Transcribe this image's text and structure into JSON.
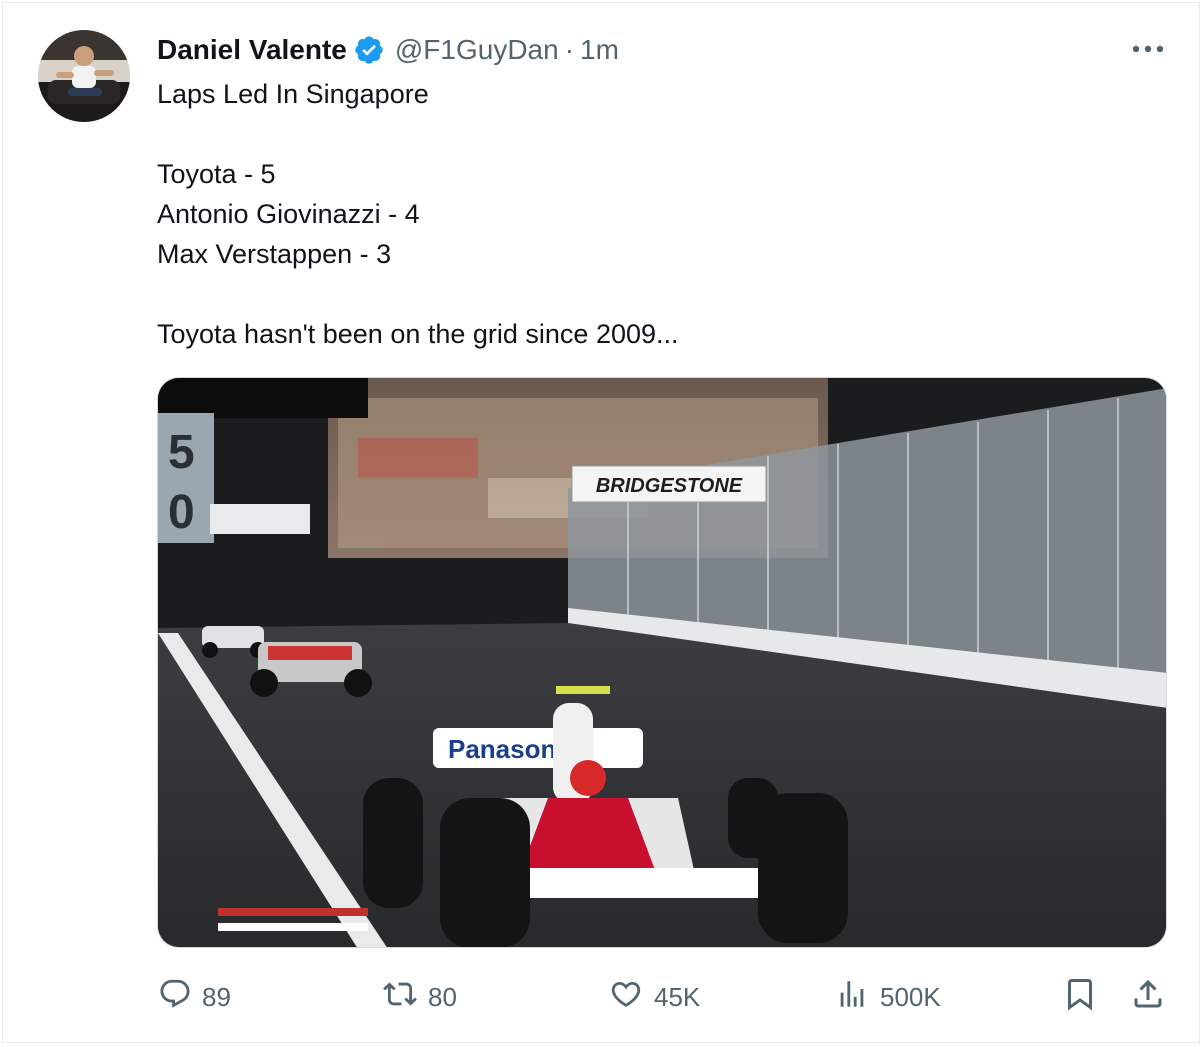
{
  "author": {
    "name": "Daniel Valente",
    "handle": "@F1GuyDan",
    "separator": "·",
    "time": "1m",
    "verified": true,
    "verified_color": "#1d9bf0",
    "avatar_icon": "avatar-photo"
  },
  "tweet": {
    "title_line": "Laps Led In Singapore",
    "list": [
      "Toyota - 5",
      "Antonio Giovinazzi - 4",
      "Max Verstappen - 3"
    ],
    "closing": "Toyota hasn't been on the grid since 2009..."
  },
  "media": {
    "sponsor_sign": "BRIDGESTONE",
    "car_sponsor": "Panasonic",
    "board_number": "50"
  },
  "actions": {
    "replies": "89",
    "retweets": "80",
    "likes": "45K",
    "views": "500K",
    "icons": [
      "reply-icon",
      "retweet-icon",
      "like-icon",
      "views-icon",
      "bookmark-icon",
      "share-icon"
    ]
  },
  "colors": {
    "text_primary": "#0f1419",
    "text_secondary": "#536471",
    "border": "#cfd9de"
  }
}
